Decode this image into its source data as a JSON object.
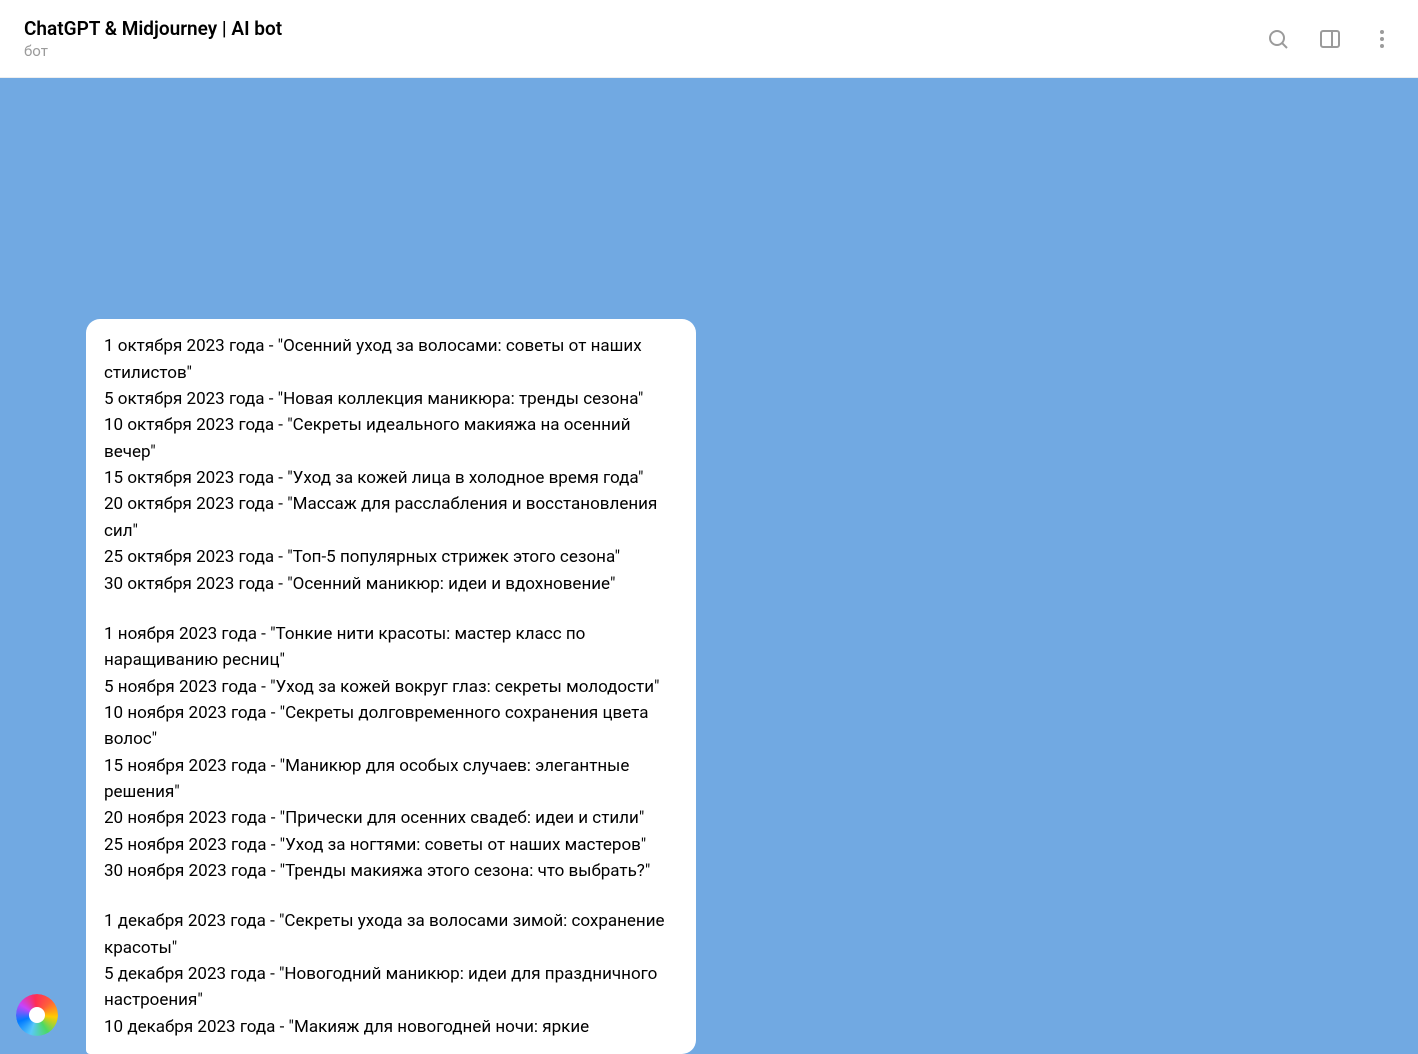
{
  "header": {
    "title": "ChatGPT & Midjourney | AI bot",
    "subtitle": "бот"
  },
  "message": {
    "blocks": [
      [
        "1 октября 2023 года - \"Осенний уход за волосами: советы от наших стилистов\"",
        "5 октября 2023 года - \"Новая коллекция маникюра: тренды сезона\"",
        "10 октября 2023 года - \"Секреты идеального макияжа на осенний вечер\"",
        "15 октября 2023 года - \"Уход за кожей лица в холодное время года\"",
        "20 октября 2023 года - \"Массаж для расслабления и восстановления сил\"",
        "25 октября 2023 года - \"Топ-5 популярных стрижек этого сезона\"",
        "30 октября 2023 года - \"Осенний маникюр: идеи и вдохновение\""
      ],
      [
        "1 ноября 2023 года - \"Тонкие нити красоты: мастер класс по наращиванию ресниц\"",
        "5 ноября 2023 года - \"Уход за кожей вокруг глаз: секреты молодости\"",
        "10 ноября 2023 года - \"Секреты долговременного сохранения цвета волос\"",
        "15 ноября 2023 года - \"Маникюр для особых случаев: элегантные решения\"",
        "20 ноября 2023 года - \"Прически для осенних свадеб: идеи и стили\"",
        "25 ноября 2023 года - \"Уход за ногтями: советы от наших мастеров\"",
        "30 ноября 2023 года - \"Тренды макияжа этого сезона: что выбрать?\""
      ],
      [
        "1 декабря 2023 года - \"Секреты ухода за волосами зимой: сохранение красоты\"",
        "5 декабря 2023 года - \"Новогодний маникюр: идеи для праздничного настроения\"",
        "10 декабря 2023 года - \"Макияж для новогодней ночи: яркие"
      ]
    ]
  }
}
